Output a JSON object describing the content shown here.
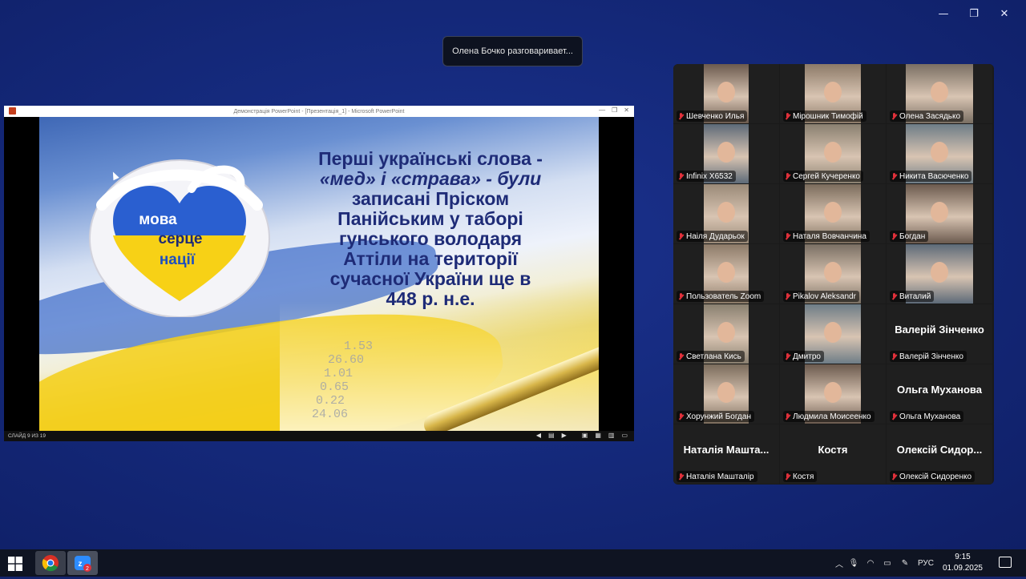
{
  "window_controls": {
    "minimize": "—",
    "restore": "❐",
    "close": "✕"
  },
  "toast": {
    "text": "Олена Бочко разговаривает..."
  },
  "share": {
    "title_bar": "Демонстрація PowerPoint - [Презентація_1] - Microsoft PowerPoint",
    "slide": {
      "heart_lines": [
        "мова",
        "серце",
        "нації"
      ],
      "text_lines": [
        "Перші українські слова -",
        "«мед»  і  «страва» -  були",
        "записані Пріском",
        "Панійським у таборі",
        "гунського володаря",
        "Аттіли на території",
        "сучасної України ще в",
        "448 р. н.е."
      ],
      "background_numbers": [
        "1.53",
        "26.60",
        "1.01",
        "0.65",
        "0.22",
        "24.06"
      ]
    },
    "status_label": "СЛАЙД 9 ИЗ 19",
    "status_icons": [
      "prev-icon",
      "menu-icon",
      "next-icon",
      "normal-view-icon",
      "slide-sorter-icon",
      "reading-view-icon",
      "slideshow-icon"
    ]
  },
  "participants": [
    {
      "name": "Шевченко Илья",
      "video": true
    },
    {
      "name": "Мірошник Тимофій",
      "video": true
    },
    {
      "name": "Олена Засядько",
      "video": true
    },
    {
      "name": "Infinix X6532",
      "video": true
    },
    {
      "name": "Сергей Кучеренко",
      "video": true
    },
    {
      "name": "Никита Васюченко",
      "video": true
    },
    {
      "name": "Наіля Дударьок",
      "video": true
    },
    {
      "name": "Наталя Вовчанчина",
      "video": true
    },
    {
      "name": "Богдан",
      "video": true
    },
    {
      "name": "Пользователь Zoom",
      "video": true
    },
    {
      "name": "Pikalov Aleksandr",
      "video": true
    },
    {
      "name": "Виталий",
      "video": true
    },
    {
      "name": "Светлана Кись",
      "video": true
    },
    {
      "name": "Дмитро",
      "video": true
    },
    {
      "name": "Валерій Зінченко",
      "video": false,
      "big_label": "Валерій Зінченко"
    },
    {
      "name": "Хорунжий Богдан",
      "video": true
    },
    {
      "name": "Людмила Моисеенко",
      "video": true
    },
    {
      "name": "Ольга Муханова",
      "video": false,
      "big_label": "Ольга Муханова"
    },
    {
      "name": "Наталія Машталір",
      "video": false,
      "big_label": "Наталія  Машта..."
    },
    {
      "name": "Костя",
      "video": false,
      "big_label": "Костя"
    },
    {
      "name": "Олексій Сидоренко",
      "video": false,
      "big_label": "Олексій  Сидор..."
    }
  ],
  "taskbar": {
    "apps": [
      {
        "name": "chrome-icon"
      },
      {
        "name": "zoom-icon",
        "badge": "2"
      }
    ],
    "tray": {
      "language": "РУС",
      "time": "9:15",
      "date": "01.09.2025"
    }
  },
  "colors": {
    "desktop_bg": "#152a7d",
    "slide_text": "#1e2b77",
    "muted_mic": "#e0303a"
  }
}
